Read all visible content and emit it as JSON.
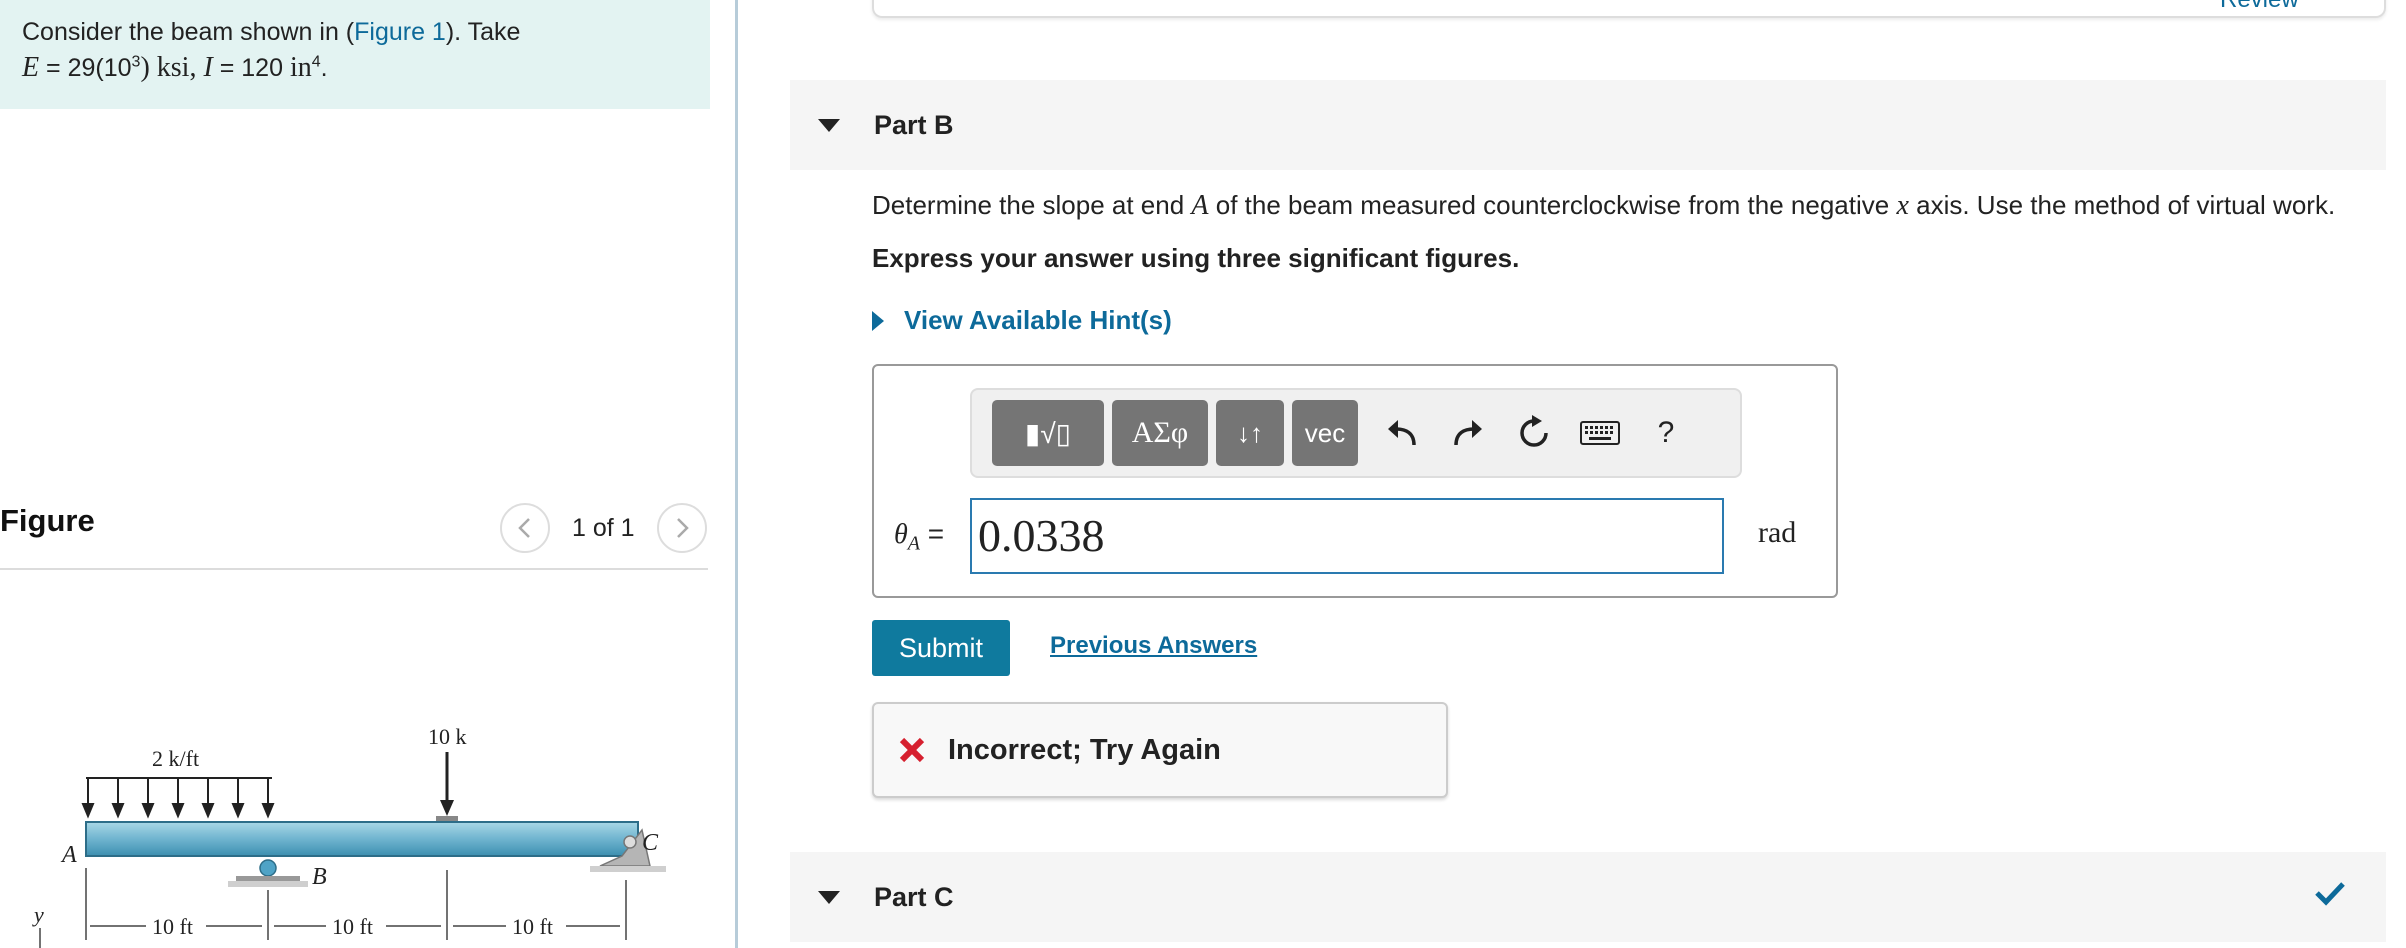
{
  "problem": {
    "text_before": "Consider the beam shown in (",
    "figure_link": "Figure 1",
    "text_after": "). Take",
    "E_var": "E",
    "E_eq": " = 29(10",
    "E_exp": "3",
    "E_unit": ") ksi, ",
    "I_var": "I",
    "I_eq": " = 120 ",
    "I_unit": "in",
    "I_exp": "4",
    "I_end": "."
  },
  "figure": {
    "title": "Figure",
    "pager_text": "1 of 1",
    "labels": {
      "load_dist": "2 k/ft",
      "load_point": "10 k",
      "A": "A",
      "B": "B",
      "C": "C",
      "y": "y",
      "dim1": "10 ft",
      "dim2": "10 ft",
      "dim3": "10 ft"
    }
  },
  "header": {
    "review_label": "Review"
  },
  "part_b": {
    "label": "Part B",
    "question_pre": "Determine the slope at end ",
    "question_var1": "A",
    "question_mid": " of the beam measured counterclockwise from the negative ",
    "question_var2": "x",
    "question_post": " axis. Use the method of virtual work.",
    "instruction": "Express your answer using three significant figures.",
    "hint_label": "View Available Hint(s)",
    "toolbar": {
      "templates_label": "▮√▯",
      "greek_label": "ΑΣφ",
      "arrows_label": "↓↑",
      "vec_label": "vec",
      "help_label": "?"
    },
    "answer_var": "θ",
    "answer_sub": "A",
    "answer_eq": " =",
    "answer_value": "0.0338",
    "unit": "rad",
    "submit_label": "Submit",
    "previous_label": "Previous Answers",
    "feedback": "Incorrect; Try Again"
  },
  "part_c": {
    "label": "Part C"
  },
  "colors": {
    "link": "#0d6a9a",
    "submit_bg": "#0f7a9e",
    "problem_bg": "#e3f3f2",
    "error": "#d6202f",
    "check": "#0d6a9a"
  }
}
